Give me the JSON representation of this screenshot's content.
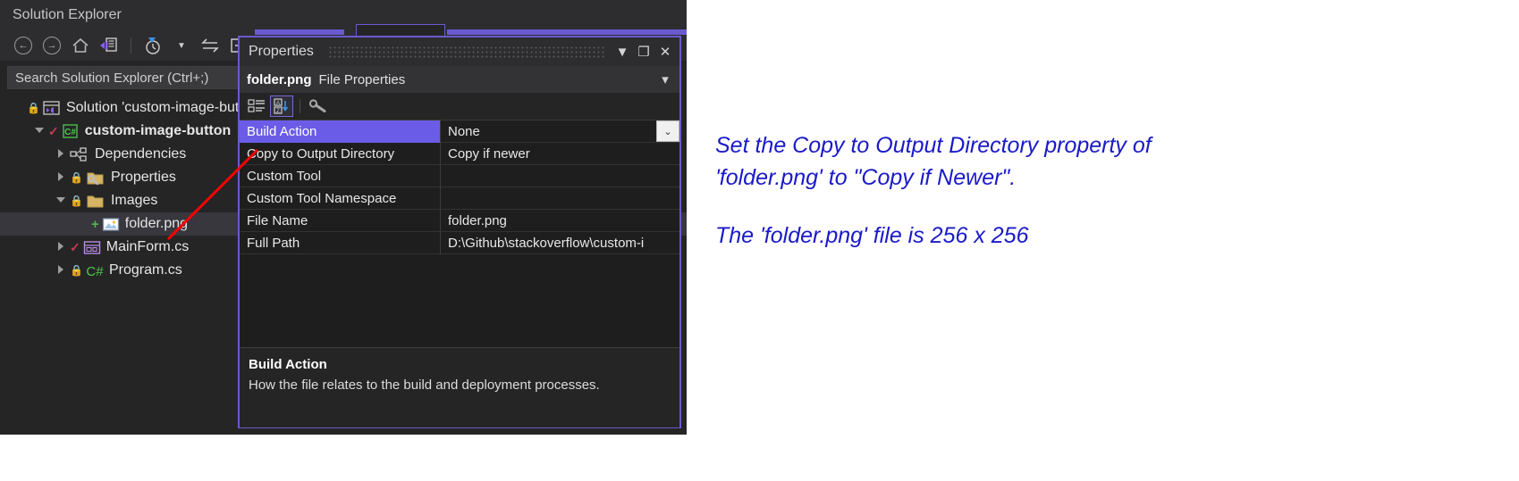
{
  "solution_explorer": {
    "title": "Solution Explorer",
    "toolbar": [
      {
        "name": "back-button",
        "glyph": "←"
      },
      {
        "name": "forward-button",
        "glyph": "→"
      },
      {
        "name": "home-button",
        "glyph": "home-icon"
      },
      {
        "name": "switch-views-button",
        "glyph": "switch-views-icon"
      },
      {
        "name": "pending-changes-filter-button",
        "glyph": "clock-icon"
      },
      {
        "name": "filter-dropdown-button",
        "glyph": "▾"
      },
      {
        "name": "sync-with-active-document-button",
        "glyph": "⇄"
      },
      {
        "name": "collapse-all-button",
        "glyph": "collapse-icon"
      }
    ],
    "search_placeholder": "Search Solution Explorer (Ctrl+;)",
    "tree": [
      {
        "label": "Solution 'custom-image-but",
        "indent": 0,
        "expander": "none",
        "lock": true,
        "check": false,
        "plus": false,
        "icon": "solution-icon",
        "bold": false,
        "selected": false
      },
      {
        "label": "custom-image-button",
        "indent": 1,
        "expander": "open",
        "lock": false,
        "check": true,
        "plus": false,
        "icon": "csharp-project-icon",
        "bold": true,
        "selected": false
      },
      {
        "label": "Dependencies",
        "indent": 2,
        "expander": "closed",
        "lock": false,
        "check": false,
        "plus": false,
        "icon": "dependencies-icon",
        "bold": false,
        "selected": false
      },
      {
        "label": "Properties",
        "indent": 2,
        "expander": "closed",
        "lock": true,
        "check": false,
        "plus": false,
        "icon": "properties-folder-icon",
        "bold": false,
        "selected": false
      },
      {
        "label": "Images",
        "indent": 2,
        "expander": "open",
        "lock": true,
        "check": false,
        "plus": false,
        "icon": "folder-icon",
        "bold": false,
        "selected": false
      },
      {
        "label": "folder.png",
        "indent": 3,
        "expander": "none",
        "lock": false,
        "check": false,
        "plus": true,
        "icon": "image-file-icon",
        "bold": false,
        "selected": true
      },
      {
        "label": "MainForm.cs",
        "indent": 2,
        "expander": "closed",
        "lock": false,
        "check": true,
        "plus": false,
        "icon": "form-icon",
        "bold": false,
        "selected": false
      },
      {
        "label": "Program.cs",
        "indent": 2,
        "expander": "closed",
        "lock": true,
        "check": false,
        "plus": false,
        "icon": "csharp-file-icon",
        "bold": false,
        "selected": false
      }
    ]
  },
  "properties_window": {
    "title": "Properties",
    "window_buttons": [
      {
        "name": "window-menu-dropdown-button",
        "glyph": "▼"
      },
      {
        "name": "maximize-button",
        "glyph": "❐"
      },
      {
        "name": "close-button",
        "glyph": "✕"
      }
    ],
    "object_name": "folder.png",
    "object_kind": "File Properties",
    "object_dropdown_glyph": "▾",
    "toolbar": [
      {
        "name": "categorized-button",
        "glyph": "categorized-icon",
        "active": false
      },
      {
        "name": "alphabetical-sort-button",
        "glyph": "sort-az-icon",
        "active": true
      },
      {
        "name": "properties-page-button",
        "glyph": "wrench-icon",
        "active": false
      }
    ],
    "grid_rows": [
      {
        "name": "Build Action",
        "value": "None",
        "selected": true,
        "has_dropdown": true
      },
      {
        "name": "Copy to Output Directory",
        "value": "Copy if newer",
        "selected": false,
        "has_dropdown": false
      },
      {
        "name": "Custom Tool",
        "value": "",
        "selected": false,
        "has_dropdown": false
      },
      {
        "name": "Custom Tool Namespace",
        "value": "",
        "selected": false,
        "has_dropdown": false
      },
      {
        "name": "File Name",
        "value": "folder.png",
        "selected": false,
        "has_dropdown": false
      },
      {
        "name": "Full Path",
        "value": "D:\\Github\\stackoverflow\\custom-i",
        "selected": false,
        "has_dropdown": false
      }
    ],
    "description": {
      "title": "Build Action",
      "text": "How the file relates to the build and deployment processes."
    }
  },
  "annotation": {
    "line1": "Set the Copy to Output Directory property of",
    "line2": "'folder.png' to \"Copy if Newer\".",
    "line3": "The 'folder.png' file is 256 x 256",
    "color": "#1a1ac8"
  },
  "callout_arrow": {
    "name": "red-arrow",
    "color": "#ff0000"
  }
}
